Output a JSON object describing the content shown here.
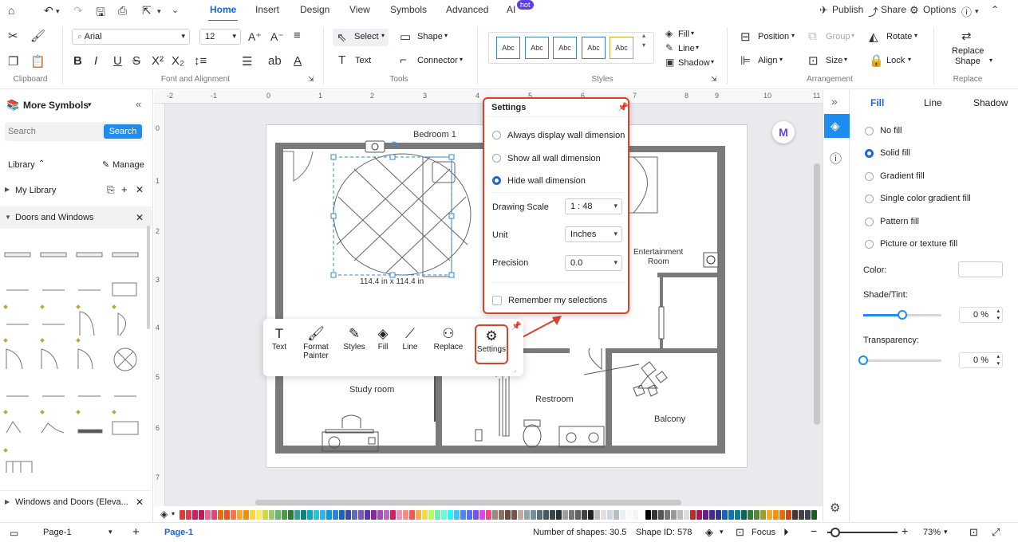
{
  "menu": {
    "tabs": [
      "Home",
      "Insert",
      "Design",
      "View",
      "Symbols",
      "Advanced",
      "AI"
    ],
    "hot_badge": "hot",
    "right": {
      "publish": "Publish",
      "share": "Share",
      "options": "Options"
    }
  },
  "ribbon": {
    "font_name": "Arial",
    "font_size": "12",
    "select_label": "Select",
    "shape_label": "Shape",
    "text_label": "Text",
    "connector_label": "Connector",
    "style_sample": "Abc",
    "fill_label": "Fill",
    "line_label": "Line",
    "shadow_label": "Shadow",
    "position_label": "Position",
    "group_label": "Group",
    "rotate_label": "Rotate",
    "align_label": "Align",
    "size_label": "Size",
    "lock_label": "Lock",
    "replace_shape_label1": "Replace",
    "replace_shape_label2": "Shape",
    "groups": {
      "clipboard": "Clipboard",
      "font": "Font and Alignment",
      "tools": "Tools",
      "styles": "Styles",
      "arrangement": "Arrangement",
      "replace": "Replace"
    }
  },
  "left_panel": {
    "title": "More Symbols",
    "search_placeholder": "Search",
    "search_button": "Search",
    "library_label": "Library",
    "manage_label": "Manage",
    "my_library": "My Library",
    "doors_windows": "Doors and Windows",
    "doors_windows_elev": "Windows and Doors (Eleva..."
  },
  "ruler": {
    "top": [
      "-2",
      "-1",
      "0",
      "1",
      "2",
      "3",
      "4",
      "5",
      "6",
      "7",
      "8",
      "9",
      "10",
      "11"
    ],
    "left": [
      "0",
      "1",
      "2",
      "3",
      "4",
      "5",
      "6",
      "7"
    ]
  },
  "floorplan": {
    "bedroom": "Bedroom 1",
    "entertainment1": "Entertainment",
    "entertainment2": "Room",
    "study": "Study room",
    "restroom": "Restroom",
    "balcony": "Balcony",
    "dimension": "114.4 in x 114.4 in"
  },
  "settings": {
    "title": "Settings",
    "options": [
      "Always display wall dimension",
      "Show all wall dimension",
      "Hide wall dimension"
    ],
    "selected_index": 2,
    "drawing_scale_label": "Drawing Scale",
    "drawing_scale_value": "1 : 48",
    "unit_label": "Unit",
    "unit_value": "Inches",
    "precision_label": "Precision",
    "precision_value": "0.0",
    "remember_label": "Remember my selections"
  },
  "float_toolbar": {
    "text": "Text",
    "format_painter1": "Format",
    "format_painter2": "Painter",
    "styles": "Styles",
    "fill": "Fill",
    "line": "Line",
    "replace": "Replace",
    "settings": "Settings"
  },
  "right_panel": {
    "tabs": [
      "Fill",
      "Line",
      "Shadow"
    ],
    "fill_options": [
      "No fill",
      "Solid fill",
      "Gradient fill",
      "Single color gradient fill",
      "Pattern fill",
      "Picture or texture fill"
    ],
    "selected_fill": 1,
    "color_label": "Color:",
    "shade_label": "Shade/Tint:",
    "shade_value": "0 %",
    "shade_level": 0.5,
    "transparency_label": "Transparency:",
    "transparency_value": "0 %",
    "transparency_level": 0
  },
  "palette_colors": [
    "#e53935",
    "#e53950",
    "#d81b60",
    "#c2185b",
    "#f06292",
    "#ec407a",
    "#ef6c00",
    "#f4511e",
    "#ff7043",
    "#ffa726",
    "#fb8c00",
    "#fdd835",
    "#ffee58",
    "#cddc39",
    "#9ccc65",
    "#66bb6a",
    "#43a047",
    "#2e7d32",
    "#26a69a",
    "#00897b",
    "#00acc1",
    "#26c6da",
    "#29b6f6",
    "#039be5",
    "#1e88e5",
    "#1565c0",
    "#3949ab",
    "#5c6bc0",
    "#7e57c2",
    "#5e35b1",
    "#8e24aa",
    "#ab47bc",
    "#ba68c8",
    "#d81b60",
    "#f48fb1",
    "#ff8a80",
    "#ff5252",
    "#ffab40",
    "#ffd740",
    "#b2ff59",
    "#69f0ae",
    "#64ffda",
    "#18ffff",
    "#40c4ff",
    "#448aff",
    "#536dfe",
    "#7c4dff",
    "#e040fb",
    "#ff4081",
    "#a1887f",
    "#8d6e63",
    "#6d4c41",
    "#795548",
    "#bcaaa4",
    "#90a4ae",
    "#78909c",
    "#546e7a",
    "#455a64",
    "#37474f",
    "#263238",
    "#9e9e9e",
    "#757575",
    "#616161",
    "#424242",
    "#212121",
    "#bdbdbd",
    "#e0e0e0",
    "#cfd8dc",
    "#b0bec5",
    "#eceff1",
    "#fafafa",
    "#f5f5f5",
    "#ffffff",
    "#000000",
    "#333333",
    "#555555",
    "#777777",
    "#999999",
    "#bbbbbb",
    "#dddddd",
    "#c62828",
    "#ad1457",
    "#6a1b9a",
    "#4527a0",
    "#283593",
    "#1565c0",
    "#0277bd",
    "#00838f",
    "#00695c",
    "#2e7d32",
    "#558b2f",
    "#9e9d24",
    "#f9a825",
    "#ff8f00",
    "#ef6c00",
    "#d84315",
    "#4e342e",
    "#424242",
    "#37474f",
    "#1b5e20"
  ],
  "status": {
    "page_select": "Page-1",
    "page_tab": "Page-1",
    "shape_count": "Number of shapes: 30.5",
    "shape_id": "Shape ID: 578",
    "focus": "Focus",
    "zoom": "73%"
  }
}
